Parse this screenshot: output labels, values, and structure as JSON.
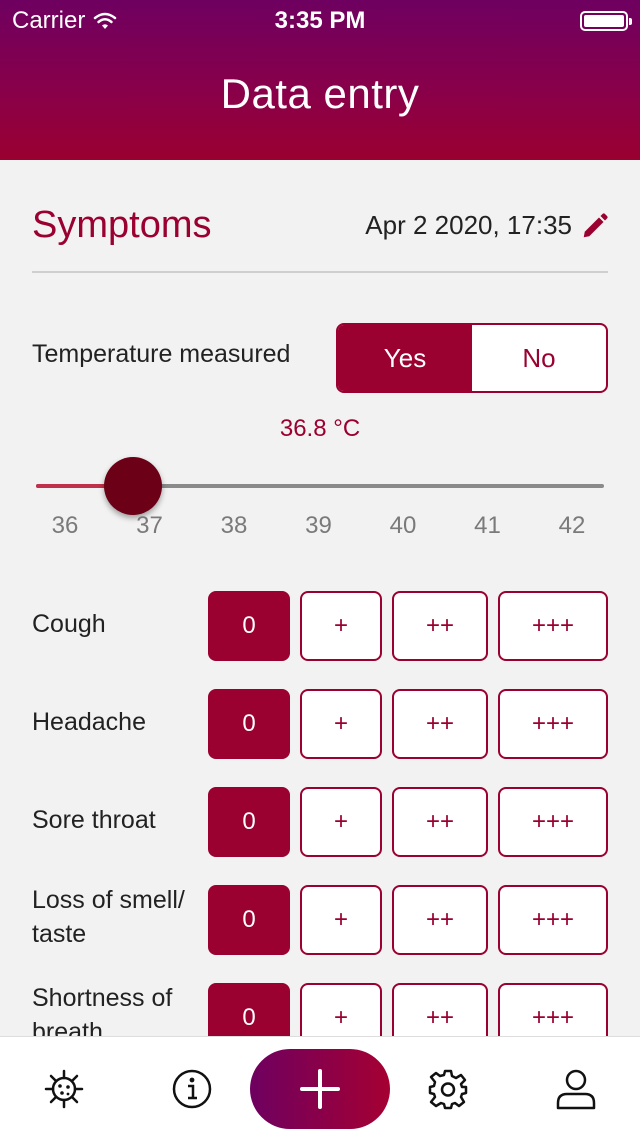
{
  "status_bar": {
    "carrier": "Carrier",
    "time": "3:35 PM"
  },
  "header": {
    "title": "Data entry"
  },
  "section": {
    "title": "Symptoms",
    "date": "Apr 2 2020, 17:35"
  },
  "temperature": {
    "label": "Temperature measured",
    "options": [
      "Yes",
      "No"
    ],
    "selected": "Yes",
    "value_text": "36.8 °C",
    "value": 36.8,
    "min": 36,
    "max": 42,
    "ticks": [
      "36",
      "37",
      "38",
      "39",
      "40",
      "41",
      "42"
    ]
  },
  "levels": [
    "0",
    "+",
    "++",
    "+++"
  ],
  "symptoms": [
    {
      "label": "Cough",
      "selected": "0"
    },
    {
      "label": "Headache",
      "selected": "0"
    },
    {
      "label": "Sore throat",
      "selected": "0"
    },
    {
      "label": "Loss of smell/ taste",
      "selected": "0"
    },
    {
      "label": "Shortness of breath",
      "selected": "0"
    }
  ],
  "tabbar": {
    "items": [
      "virus-icon",
      "info-icon",
      "add-icon",
      "settings-icon",
      "profile-icon"
    ]
  },
  "colors": {
    "accent": "#9a0030",
    "header_top": "#6e0060",
    "knob": "#6b0016"
  }
}
